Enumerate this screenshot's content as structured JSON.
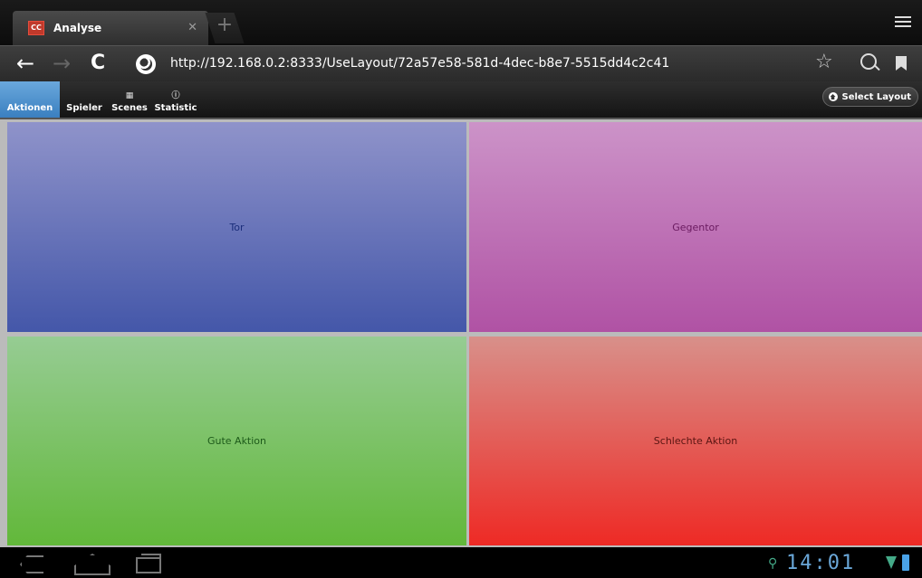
{
  "browser": {
    "tab": {
      "title": "Analyse",
      "favicon_text": "CC"
    },
    "url": "http://192.168.0.2:8333/UseLayout/72a57e58-581d-4dec-b8e7-5515dd4c2c41",
    "icons": {
      "back": "arrow-left-icon",
      "forward": "arrow-right-icon",
      "reload": "reload-icon",
      "site": "globe-icon",
      "bookmark_star": "star-icon",
      "search": "search-icon",
      "bookmarks": "bookmark-icon",
      "menu": "menu-icon"
    }
  },
  "app_toolbar": {
    "tabs": [
      {
        "label": "Aktionen",
        "active": true
      },
      {
        "label": "Spieler",
        "active": false
      },
      {
        "label": "Scenes",
        "active": false,
        "icon": "grid-icon"
      },
      {
        "label": "Statistic",
        "active": false,
        "icon": "info-icon"
      }
    ],
    "select_layout_label": "Select Layout"
  },
  "actions": [
    {
      "label": "Tor",
      "color": "#4457a9"
    },
    {
      "label": "Gegentor",
      "color": "#b052a4"
    },
    {
      "label": "Gute Aktion",
      "color": "#62b83a"
    },
    {
      "label": "Schlechte Aktion",
      "color": "#ee2a25"
    }
  ],
  "system_bar": {
    "time": "14:01"
  }
}
